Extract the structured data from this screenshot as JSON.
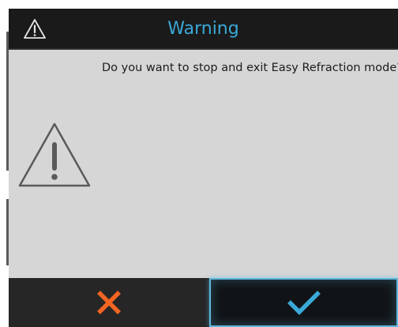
{
  "dialog": {
    "title": "Warning",
    "message": "Do you want to stop and exit Easy Refraction mode?",
    "title_icon": "warning-triangle-icon",
    "body_icon": "warning-triangle-icon"
  },
  "buttons": {
    "cancel": {
      "icon": "close-x-icon",
      "color": "#f26522"
    },
    "confirm": {
      "icon": "checkmark-icon",
      "color": "#3aa9d8"
    }
  },
  "colors": {
    "title_text": "#3aa9d8",
    "header_bg": "#1a1a1a",
    "body_bg": "#d6d6d6",
    "footer_bg": "#1e1e1e",
    "cancel_accent": "#f26522",
    "confirm_accent": "#3aa9d8"
  }
}
